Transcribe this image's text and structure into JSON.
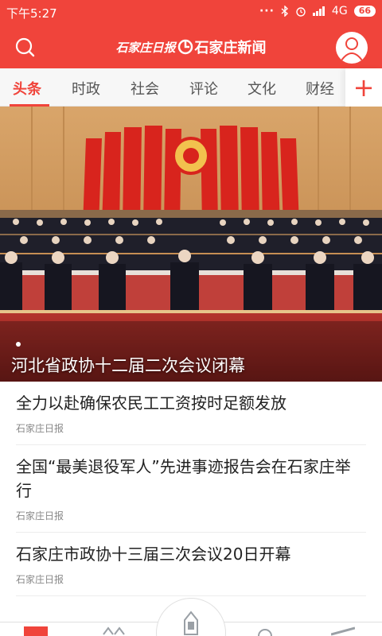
{
  "status_bar": {
    "time": "下午5:27",
    "dots": "···",
    "network": "4G",
    "battery": "66"
  },
  "header": {
    "brand_script": "石家庄日报",
    "brand_name": "石家庄新闻"
  },
  "tabs": [
    {
      "label": "头条",
      "active": true
    },
    {
      "label": "时政"
    },
    {
      "label": "社会"
    },
    {
      "label": "评论"
    },
    {
      "label": "文化"
    },
    {
      "label": "财经"
    }
  ],
  "add_tab_label": "+",
  "hero": {
    "title": "河北省政协十二届二次会议闭幕"
  },
  "news": [
    {
      "title": "全力以赴确保农民工工资按时足额发放",
      "source": "石家庄日报"
    },
    {
      "title": "全国“最美退役军人”先进事迹报告会在石家庄举行",
      "source": "石家庄日报"
    },
    {
      "title": "石家庄市政协十三届三次会议20日开幕",
      "source": "石家庄日报"
    }
  ],
  "colors": {
    "brand_red": "#f0443b"
  },
  "icons": {
    "search": "search-icon",
    "avatar": "user-icon"
  }
}
